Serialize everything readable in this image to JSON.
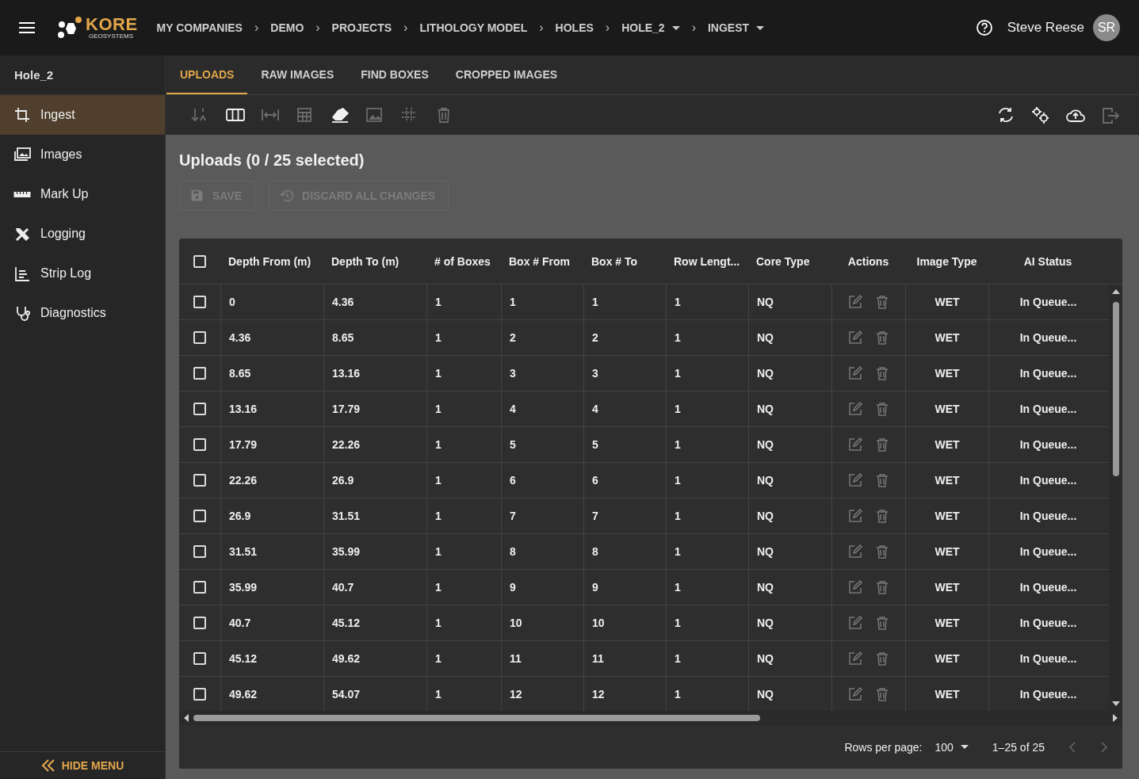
{
  "app": {
    "logo_main": "KORE",
    "logo_sub": "GEOSYSTEMS"
  },
  "breadcrumbs": [
    {
      "label": "MY COMPANIES",
      "dropdown": false
    },
    {
      "label": "DEMO",
      "dropdown": false
    },
    {
      "label": "PROJECTS",
      "dropdown": false
    },
    {
      "label": "LITHOLOGY MODEL",
      "dropdown": false
    },
    {
      "label": "HOLES",
      "dropdown": false
    },
    {
      "label": "HOLE_2",
      "dropdown": true
    },
    {
      "label": "INGEST",
      "dropdown": true
    }
  ],
  "breadcrumb_separator": "›",
  "user": {
    "name": "Steve Reese",
    "initials": "SR"
  },
  "sidebar": {
    "title": "Hole_2",
    "items": [
      {
        "label": "Ingest",
        "selected": true
      },
      {
        "label": "Images",
        "selected": false
      },
      {
        "label": "Mark Up",
        "selected": false
      },
      {
        "label": "Logging",
        "selected": false
      },
      {
        "label": "Strip Log",
        "selected": false
      },
      {
        "label": "Diagnostics",
        "selected": false
      }
    ],
    "hide_menu": "HIDE MENU"
  },
  "tabs": [
    {
      "label": "UPLOADS",
      "selected": true
    },
    {
      "label": "RAW IMAGES",
      "selected": false
    },
    {
      "label": "FIND BOXES",
      "selected": false
    },
    {
      "label": "CROPPED IMAGES",
      "selected": false
    }
  ],
  "toolbar": {
    "left": [
      {
        "disabled": true
      },
      {
        "disabled": false
      },
      {
        "disabled": true
      },
      {
        "disabled": true
      },
      {
        "disabled": false
      },
      {
        "disabled": true
      },
      {
        "disabled": true
      },
      {
        "disabled": true
      }
    ],
    "right": [
      {
        "disabled": false
      },
      {
        "disabled": false
      },
      {
        "disabled": false
      },
      {
        "disabled": true
      }
    ]
  },
  "title": "Uploads (0 / 25 selected)",
  "buttons": [
    {
      "label": "SAVE",
      "disabled": true
    },
    {
      "label": "DISCARD ALL CHANGES",
      "disabled": true
    }
  ],
  "table": {
    "select_all": {
      "checked": false
    },
    "columns": [
      "Depth From (m)",
      "Depth To (m)",
      "# of Boxes",
      "Box # From",
      "Box # To",
      "Row Lengt...",
      "Core Type",
      "Actions",
      "Image Type",
      "AI Status"
    ],
    "rows": [
      {
        "checked": false,
        "cells": [
          "0",
          "4.36",
          "1",
          "1",
          "1",
          "1",
          "NQ",
          "",
          "WET",
          "In Queue..."
        ]
      },
      {
        "checked": false,
        "cells": [
          "4.36",
          "8.65",
          "1",
          "2",
          "2",
          "1",
          "NQ",
          "",
          "WET",
          "In Queue..."
        ]
      },
      {
        "checked": false,
        "cells": [
          "8.65",
          "13.16",
          "1",
          "3",
          "3",
          "1",
          "NQ",
          "",
          "WET",
          "In Queue..."
        ]
      },
      {
        "checked": false,
        "cells": [
          "13.16",
          "17.79",
          "1",
          "4",
          "4",
          "1",
          "NQ",
          "",
          "WET",
          "In Queue..."
        ]
      },
      {
        "checked": false,
        "cells": [
          "17.79",
          "22.26",
          "1",
          "5",
          "5",
          "1",
          "NQ",
          "",
          "WET",
          "In Queue..."
        ]
      },
      {
        "checked": false,
        "cells": [
          "22.26",
          "26.9",
          "1",
          "6",
          "6",
          "1",
          "NQ",
          "",
          "WET",
          "In Queue..."
        ]
      },
      {
        "checked": false,
        "cells": [
          "26.9",
          "31.51",
          "1",
          "7",
          "7",
          "1",
          "NQ",
          "",
          "WET",
          "In Queue..."
        ]
      },
      {
        "checked": false,
        "cells": [
          "31.51",
          "35.99",
          "1",
          "8",
          "8",
          "1",
          "NQ",
          "",
          "WET",
          "In Queue..."
        ]
      },
      {
        "checked": false,
        "cells": [
          "35.99",
          "40.7",
          "1",
          "9",
          "9",
          "1",
          "NQ",
          "",
          "WET",
          "In Queue..."
        ]
      },
      {
        "checked": false,
        "cells": [
          "40.7",
          "45.12",
          "1",
          "10",
          "10",
          "1",
          "NQ",
          "",
          "WET",
          "In Queue..."
        ]
      },
      {
        "checked": false,
        "cells": [
          "45.12",
          "49.62",
          "1",
          "11",
          "11",
          "1",
          "NQ",
          "",
          "WET",
          "In Queue..."
        ]
      },
      {
        "checked": false,
        "cells": [
          "49.62",
          "54.07",
          "1",
          "12",
          "12",
          "1",
          "NQ",
          "",
          "WET",
          "In Queue..."
        ]
      }
    ]
  },
  "pagination": {
    "rows_per_page_label": "Rows per page:",
    "rows_per_page": "100",
    "range": "1–25 of 25"
  }
}
